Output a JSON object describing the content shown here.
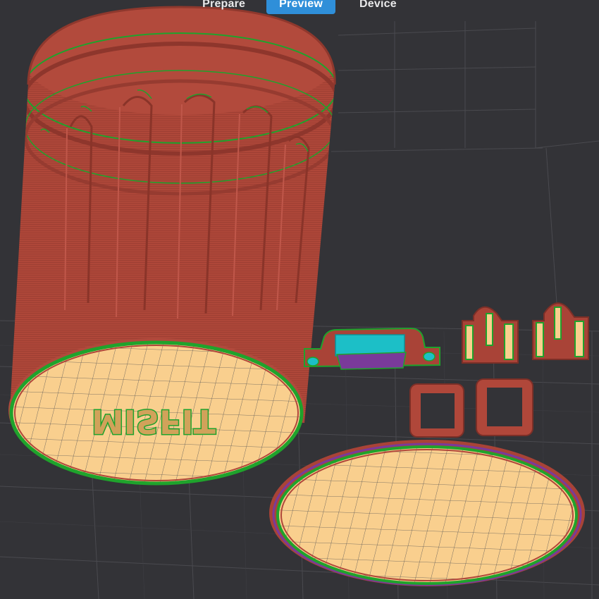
{
  "tabs": [
    {
      "label": "Prepare",
      "active": false
    },
    {
      "label": "Preview",
      "active": true
    },
    {
      "label": "Device",
      "active": false
    }
  ],
  "colors": {
    "background": "#333337",
    "wall": "#b0473a",
    "top_surface": "#f9cf8e",
    "outer_wall_line": "#1fa32c",
    "support": "#1cbfc7",
    "inner_line": "#7a3a9a",
    "tab_active": "#2f8fd9"
  },
  "models": {
    "logo_text": "MISFIT"
  }
}
